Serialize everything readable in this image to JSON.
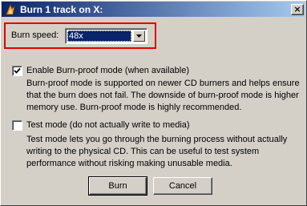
{
  "window": {
    "title": "Burn 1 track on X:",
    "app_icon": "flame-icon",
    "close_label": "×"
  },
  "speed": {
    "label": "Burn speed:",
    "value": "48x"
  },
  "burnproof": {
    "label": "Enable Burn-proof mode (when available)",
    "checked": true,
    "description": [
      "Burn-proof mode is supported on newer CD burners and helps ensure",
      "that the burn does not fail. The downside of burn-proof mode is higher",
      "memory use. Burn-proof mode is highly recommended."
    ]
  },
  "testmode": {
    "label": "Test mode (do not actually write to media)",
    "checked": false,
    "description": [
      "Test mode lets you go through the burning process without actually",
      "writing to the physical CD. This can be useful to test system",
      "performance without risking making unusable media."
    ]
  },
  "buttons": {
    "burn": "Burn",
    "cancel": "Cancel"
  },
  "colors": {
    "highlight_box": "#e10000",
    "title_bar_start": "#0a246a",
    "title_bar_end": "#a6caf0"
  }
}
